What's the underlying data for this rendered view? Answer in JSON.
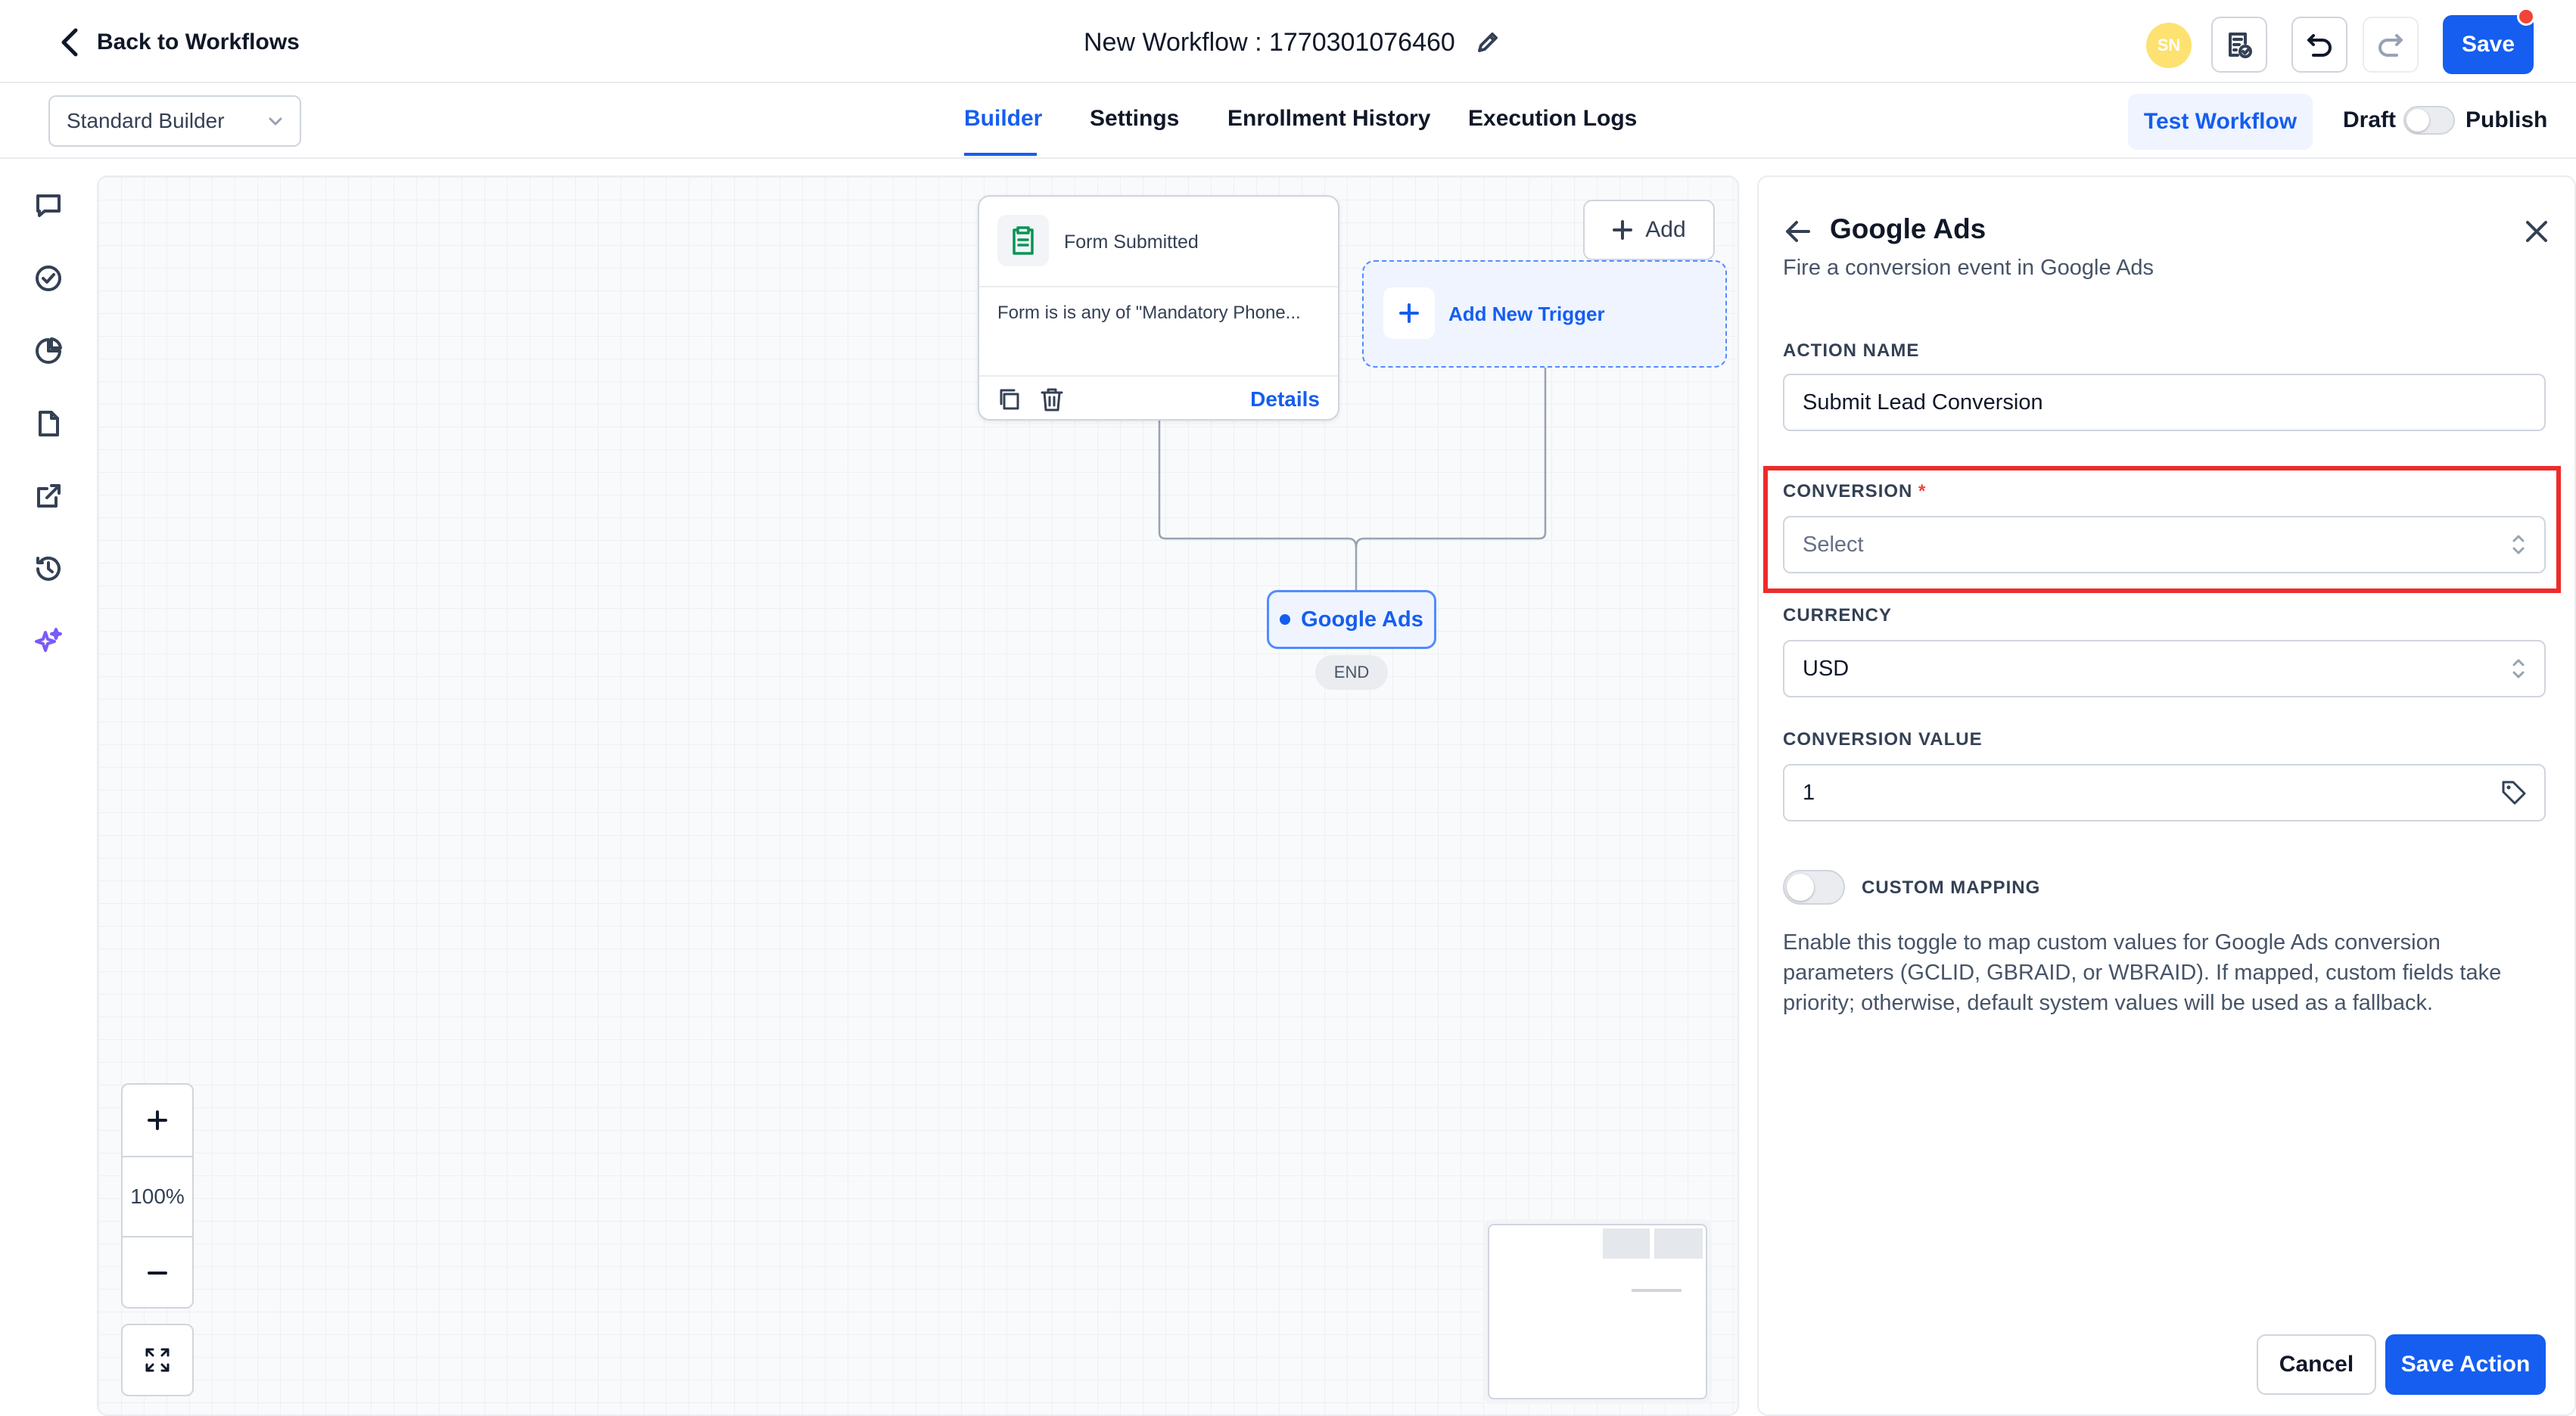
{
  "header": {
    "back_label": "Back to Workflows",
    "workflow_title": "New Workflow : 1770301076460",
    "avatar_initials": "SN",
    "save_label": "Save"
  },
  "subheader": {
    "builder_mode": "Standard Builder",
    "tabs": [
      {
        "label": "Builder",
        "active": true
      },
      {
        "label": "Settings",
        "active": false
      },
      {
        "label": "Enrollment History",
        "active": false
      },
      {
        "label": "Execution Logs",
        "active": false
      }
    ],
    "test_workflow_label": "Test Workflow",
    "draft_label": "Draft",
    "publish_label": "Publish",
    "published": false
  },
  "sidebar": {
    "icons": [
      "chat-icon",
      "check-circle-icon",
      "pie-chart-icon",
      "file-icon",
      "external-link-icon",
      "history-icon",
      "sparkle-icon"
    ]
  },
  "canvas": {
    "trigger": {
      "title": "Form Submitted",
      "description": "Form is is any of \"Mandatory Phone...",
      "details_label": "Details"
    },
    "add_label": "Add",
    "add_trigger_label": "Add New Trigger",
    "action_node_label": "Google Ads",
    "end_label": "END",
    "zoom_level": "100%"
  },
  "panel": {
    "title": "Google Ads",
    "subtitle": "Fire a conversion event in Google Ads",
    "fields": {
      "action_name": {
        "label": "ACTION NAME",
        "value": "Submit Lead Conversion"
      },
      "conversion": {
        "label": "CONVERSION",
        "required_mark": "*",
        "placeholder": "Select"
      },
      "currency": {
        "label": "CURRENCY",
        "value": "USD"
      },
      "conversion_value": {
        "label": "CONVERSION VALUE",
        "value": "1"
      }
    },
    "custom_mapping": {
      "label": "CUSTOM MAPPING",
      "enabled": false,
      "help": "Enable this toggle to map custom values for Google Ads conversion parameters (GCLID, GBRAID, or WBRAID). If mapped, custom fields take priority; otherwise, default system values will be used as a fallback."
    },
    "cancel_label": "Cancel",
    "save_action_label": "Save Action"
  },
  "colors": {
    "primary": "#155eef",
    "highlight": "#ef2b2b",
    "notification": "#f04438",
    "avatar": "#fde272"
  }
}
